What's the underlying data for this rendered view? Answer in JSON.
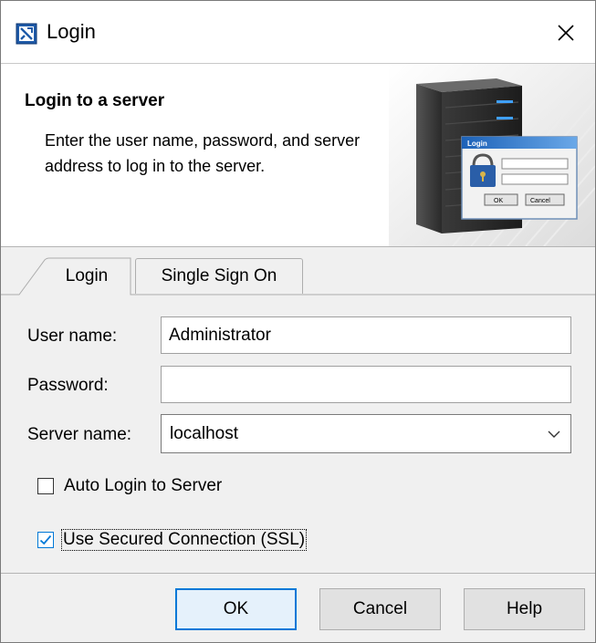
{
  "window": {
    "title": "Login",
    "icon": "login-app-icon",
    "close_icon": "close-icon"
  },
  "header": {
    "title": "Login to a server",
    "description": "Enter the user name, password, and server address to log in to the server.",
    "illustration": "server-with-login-window",
    "mini_login_title": "Login",
    "mini_ok": "OK",
    "mini_cancel": "Cancel"
  },
  "tabs": [
    {
      "label": "Login",
      "selected": true
    },
    {
      "label": "Single Sign On",
      "selected": false
    }
  ],
  "form": {
    "username_label": "User name:",
    "username_value": "Administrator",
    "password_label": "Password:",
    "password_value": "",
    "server_label": "Server name:",
    "server_value": "localhost",
    "auto_login_label": "Auto Login to Server",
    "auto_login_checked": false,
    "ssl_label": "Use Secured Connection (SSL)",
    "ssl_checked": true
  },
  "buttons": {
    "ok": "OK",
    "cancel": "Cancel",
    "help": "Help"
  },
  "colors": {
    "accent": "#0078d7",
    "window_bg": "#f0f0f0",
    "button_bg": "#e1e1e1"
  }
}
